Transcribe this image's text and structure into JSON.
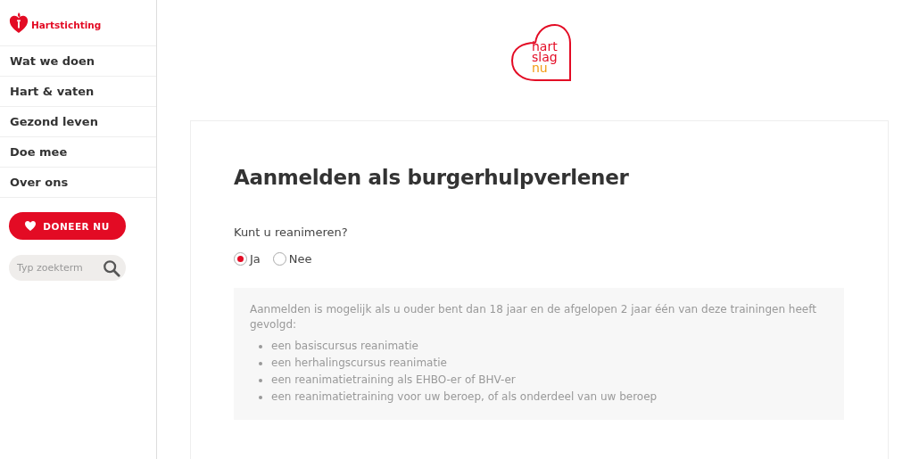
{
  "sidebar": {
    "brand": "Hartstichting",
    "nav": [
      {
        "label": "Wat we doen"
      },
      {
        "label": "Hart & vaten"
      },
      {
        "label": "Gezond leven"
      },
      {
        "label": "Doe mee"
      },
      {
        "label": "Over ons"
      }
    ],
    "donate_button": "DONEER NU",
    "search": {
      "placeholder": "Typ zoekterm"
    }
  },
  "logo": {
    "lines": [
      "hart",
      "slag",
      "nu"
    ]
  },
  "form": {
    "title": "Aanmelden als burgerhulpverlener",
    "question": "Kunt u reanimeren?",
    "options": [
      {
        "label": "Ja",
        "selected": true
      },
      {
        "label": "Nee",
        "selected": false
      }
    ],
    "info": {
      "text": "Aanmelden is mogelijk als u ouder bent dan 18 jaar en de afgelopen 2 jaar één van deze trainingen heeft gevolgd:",
      "items": [
        "een basiscursus reanimatie",
        "een herhalingscursus reanimatie",
        "een reanimatietraining als EHBO-er of BHV-er",
        "een reanimatietraining voor uw beroep, of als onderdeel van uw beroep"
      ]
    }
  }
}
